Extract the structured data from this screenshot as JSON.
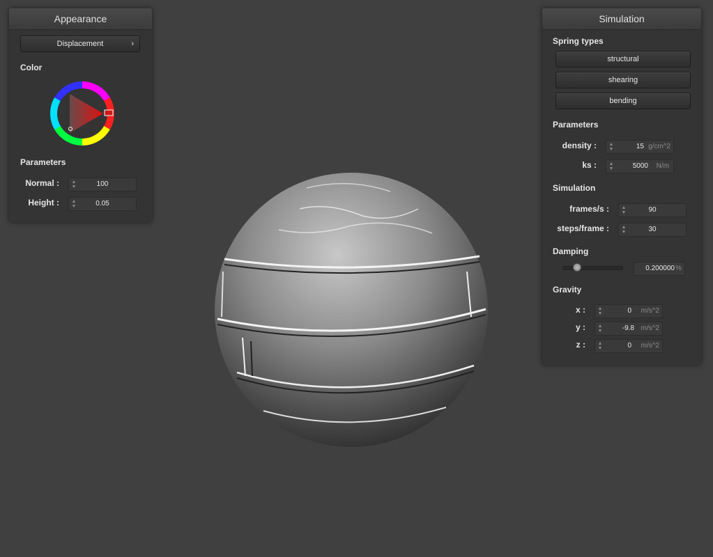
{
  "appearance": {
    "title": "Appearance",
    "shader_button": "Displacement",
    "color_label": "Color",
    "parameters_label": "Parameters",
    "normal_label": "Normal :",
    "normal_value": "100",
    "height_label": "Height :",
    "height_value": "0.05",
    "selected_color": "#cc1a1a"
  },
  "simulation": {
    "title": "Simulation",
    "spring_types_label": "Spring types",
    "springs": [
      "structural",
      "shearing",
      "bending"
    ],
    "parameters_label": "Parameters",
    "density_label": "density :",
    "density_value": "15",
    "density_unit": "g/cm^2",
    "ks_label": "ks :",
    "ks_value": "5000",
    "ks_unit": "N/m",
    "simulation_label": "Simulation",
    "fps_label": "frames/s :",
    "fps_value": "90",
    "steps_label": "steps/frame :",
    "steps_value": "30",
    "damping_label": "Damping",
    "damping_value": "0.200000",
    "damping_unit": "%",
    "damping_fraction": 0.2,
    "gravity_label": "Gravity",
    "gx_label": "x :",
    "gx_value": "0",
    "gy_label": "y :",
    "gy_value": "-9.8",
    "gz_label": "z :",
    "gz_value": "0",
    "gravity_unit": "m/s^2"
  },
  "icons": {
    "spinner": "updown-arrows-icon",
    "chevron": "chevron-right-icon"
  }
}
